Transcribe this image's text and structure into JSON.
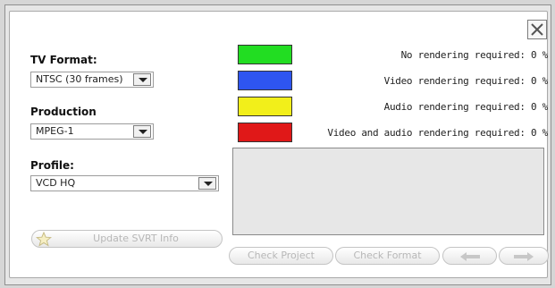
{
  "tv_format": {
    "label": "TV Format:",
    "value": "NTSC (30 frames)"
  },
  "production": {
    "label": "Production",
    "value": "MPEG-1"
  },
  "profile": {
    "label": "Profile:",
    "value": "VCD HQ"
  },
  "legend": [
    {
      "color": "#22dd22",
      "text": "No rendering required: 0 %"
    },
    {
      "color": "#2e55f0",
      "text": "Video rendering required: 0 %"
    },
    {
      "color": "#f2ef1a",
      "text": "Audio rendering required: 0 %"
    },
    {
      "color": "#e01818",
      "text": "Video and audio rendering required: 0 %"
    }
  ],
  "buttons": {
    "update_svrt": "Update SVRT Info",
    "check_project": "Check Project",
    "check_format": "Check Format"
  },
  "icons": {
    "close": "close-icon",
    "star": "star-icon",
    "prev": "arrow-left-icon",
    "next": "arrow-right-icon"
  }
}
